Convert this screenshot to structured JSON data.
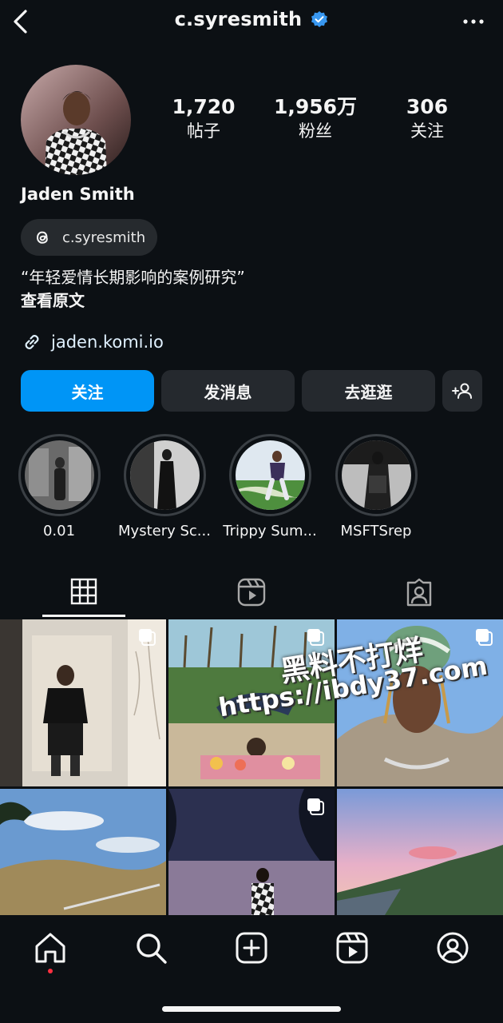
{
  "header": {
    "username": "c.syresmith"
  },
  "profile": {
    "name": "Jaden Smith",
    "threads_handle": "c.syresmith",
    "bio": "“年轻爱情长期影响的案例研究”",
    "bio_more": "查看原文",
    "link": "jaden.komi.io"
  },
  "stats": [
    {
      "value": "1,720",
      "label": "帖子"
    },
    {
      "value": "1,956万",
      "label": "粉丝"
    },
    {
      "value": "306",
      "label": "关注"
    }
  ],
  "buttons": {
    "follow": "关注",
    "message": "发消息",
    "shop": "去逛逛"
  },
  "highlights": [
    {
      "label": "0.01"
    },
    {
      "label": "Mystery Sc..."
    },
    {
      "label": "Trippy Sum..."
    },
    {
      "label": "MSFTSrep"
    }
  ],
  "watermark": {
    "line1": "黑料不打烊",
    "line2": "https://ibdy37.com"
  },
  "colors": {
    "accent": "#0095f6",
    "background": "#0c1014",
    "button": "#25292e",
    "notification": "#ff3040"
  }
}
